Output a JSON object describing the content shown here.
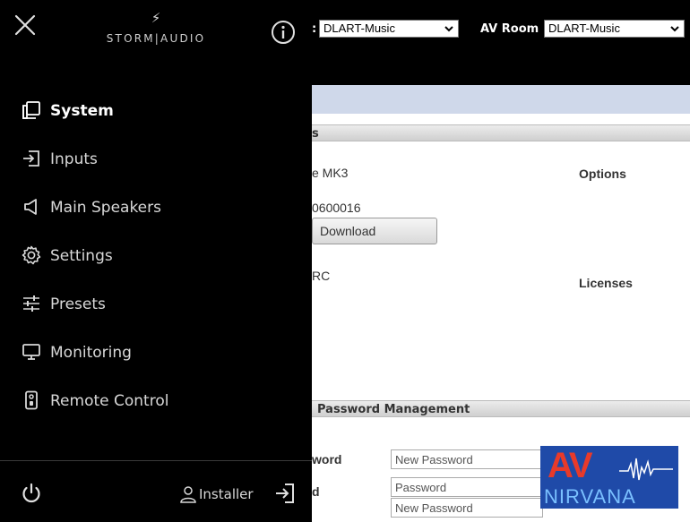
{
  "header": {
    "logo_text": "STORM|AUDIO",
    "logo_bolt": "⚡",
    "selector1_label": ":",
    "selector1_value": "DLART-Music",
    "room_label": "AV Room :",
    "room_value": "DLART-Music"
  },
  "sidebar": {
    "items": [
      {
        "label": "System",
        "icon": "system-icon",
        "active": true
      },
      {
        "label": "Inputs",
        "icon": "input-icon"
      },
      {
        "label": "Main Speakers",
        "icon": "speaker-icon"
      },
      {
        "label": "Settings",
        "icon": "gear-icon"
      },
      {
        "label": "Presets",
        "icon": "sliders-icon"
      },
      {
        "label": "Monitoring",
        "icon": "monitor-icon"
      },
      {
        "label": "Remote Control",
        "icon": "remote-icon"
      }
    ],
    "user_label": "Installer"
  },
  "page": {
    "section1_title": "s",
    "model_text": "e MK3",
    "serial_text": "0600016",
    "rc_text": "RC",
    "options_label": "Options",
    "licenses_label": "Licenses",
    "download_label": "Download",
    "section2_title": "Password Management",
    "password_label_1": "word",
    "password_label_2": "d",
    "password_placeholder_1": "New Password",
    "password_placeholder_2": "Password",
    "password_placeholder_3": "New Password"
  },
  "watermark": {
    "brand_top": "AV",
    "brand_bottom": "NIRVANA"
  },
  "colors": {
    "background": "#000000",
    "sidebar_text": "#d8d8d8",
    "page_header": "#cfd8ea",
    "watermark_bg": "#1f4aa8",
    "watermark_red": "#e83a2a"
  }
}
